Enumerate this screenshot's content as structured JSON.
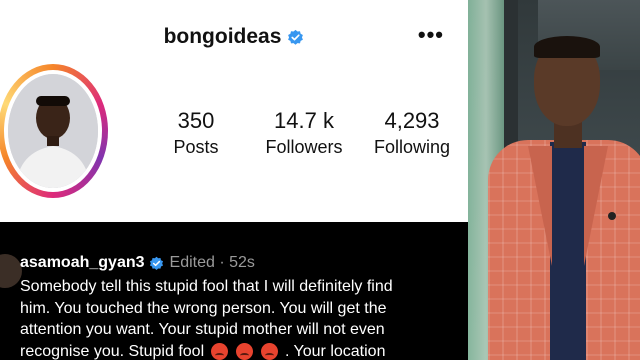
{
  "profile": {
    "username": "bongoideas",
    "verified": true,
    "menu_icon": "more-horizontal-icon",
    "stats": [
      {
        "value": "350",
        "label": "Posts"
      },
      {
        "value": "14.7 k",
        "label": "Followers"
      },
      {
        "value": "4,293",
        "label": "Following"
      }
    ]
  },
  "comment": {
    "user": "asamoah_gyan3",
    "verified": true,
    "meta": "Edited · 52s",
    "line1": "Somebody tell this stupid fool that I will definitely find",
    "line2": "him. You touched the wrong person. You will get the",
    "line3": "attention you want. Your stupid mother will not even",
    "line4a": "recognise you. Stupid fool",
    "line4b": ". Your location",
    "emoji_icon": "angry-face-icon"
  },
  "colors": {
    "verified_blue": "#3897f0",
    "meta_gray": "#9a9a9a"
  }
}
